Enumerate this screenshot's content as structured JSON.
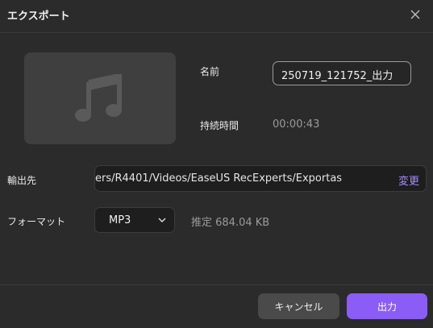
{
  "dialog": {
    "title": "エクスポート"
  },
  "icons": {
    "close": "close-icon",
    "thumbnail": "music-note-icon",
    "dropdown": "chevron-down-icon"
  },
  "fields": {
    "name_label": "名前",
    "name_value": "250719_121752_出力",
    "duration_label": "持続時間",
    "duration_value": "00:00:43",
    "output_label": "輸出先",
    "output_path": "ers/R4401/Videos/EaseUS RecExperts/Exportas",
    "change_label": "変更",
    "format_label": "フォーマット",
    "format_value": "MP3",
    "estimate_text": "推定 684.04 KB"
  },
  "buttons": {
    "cancel": "キャンセル",
    "export": "出力"
  },
  "colors": {
    "accent": "#8b5cf6",
    "link": "#a58cff",
    "background": "#2b2b2b"
  }
}
